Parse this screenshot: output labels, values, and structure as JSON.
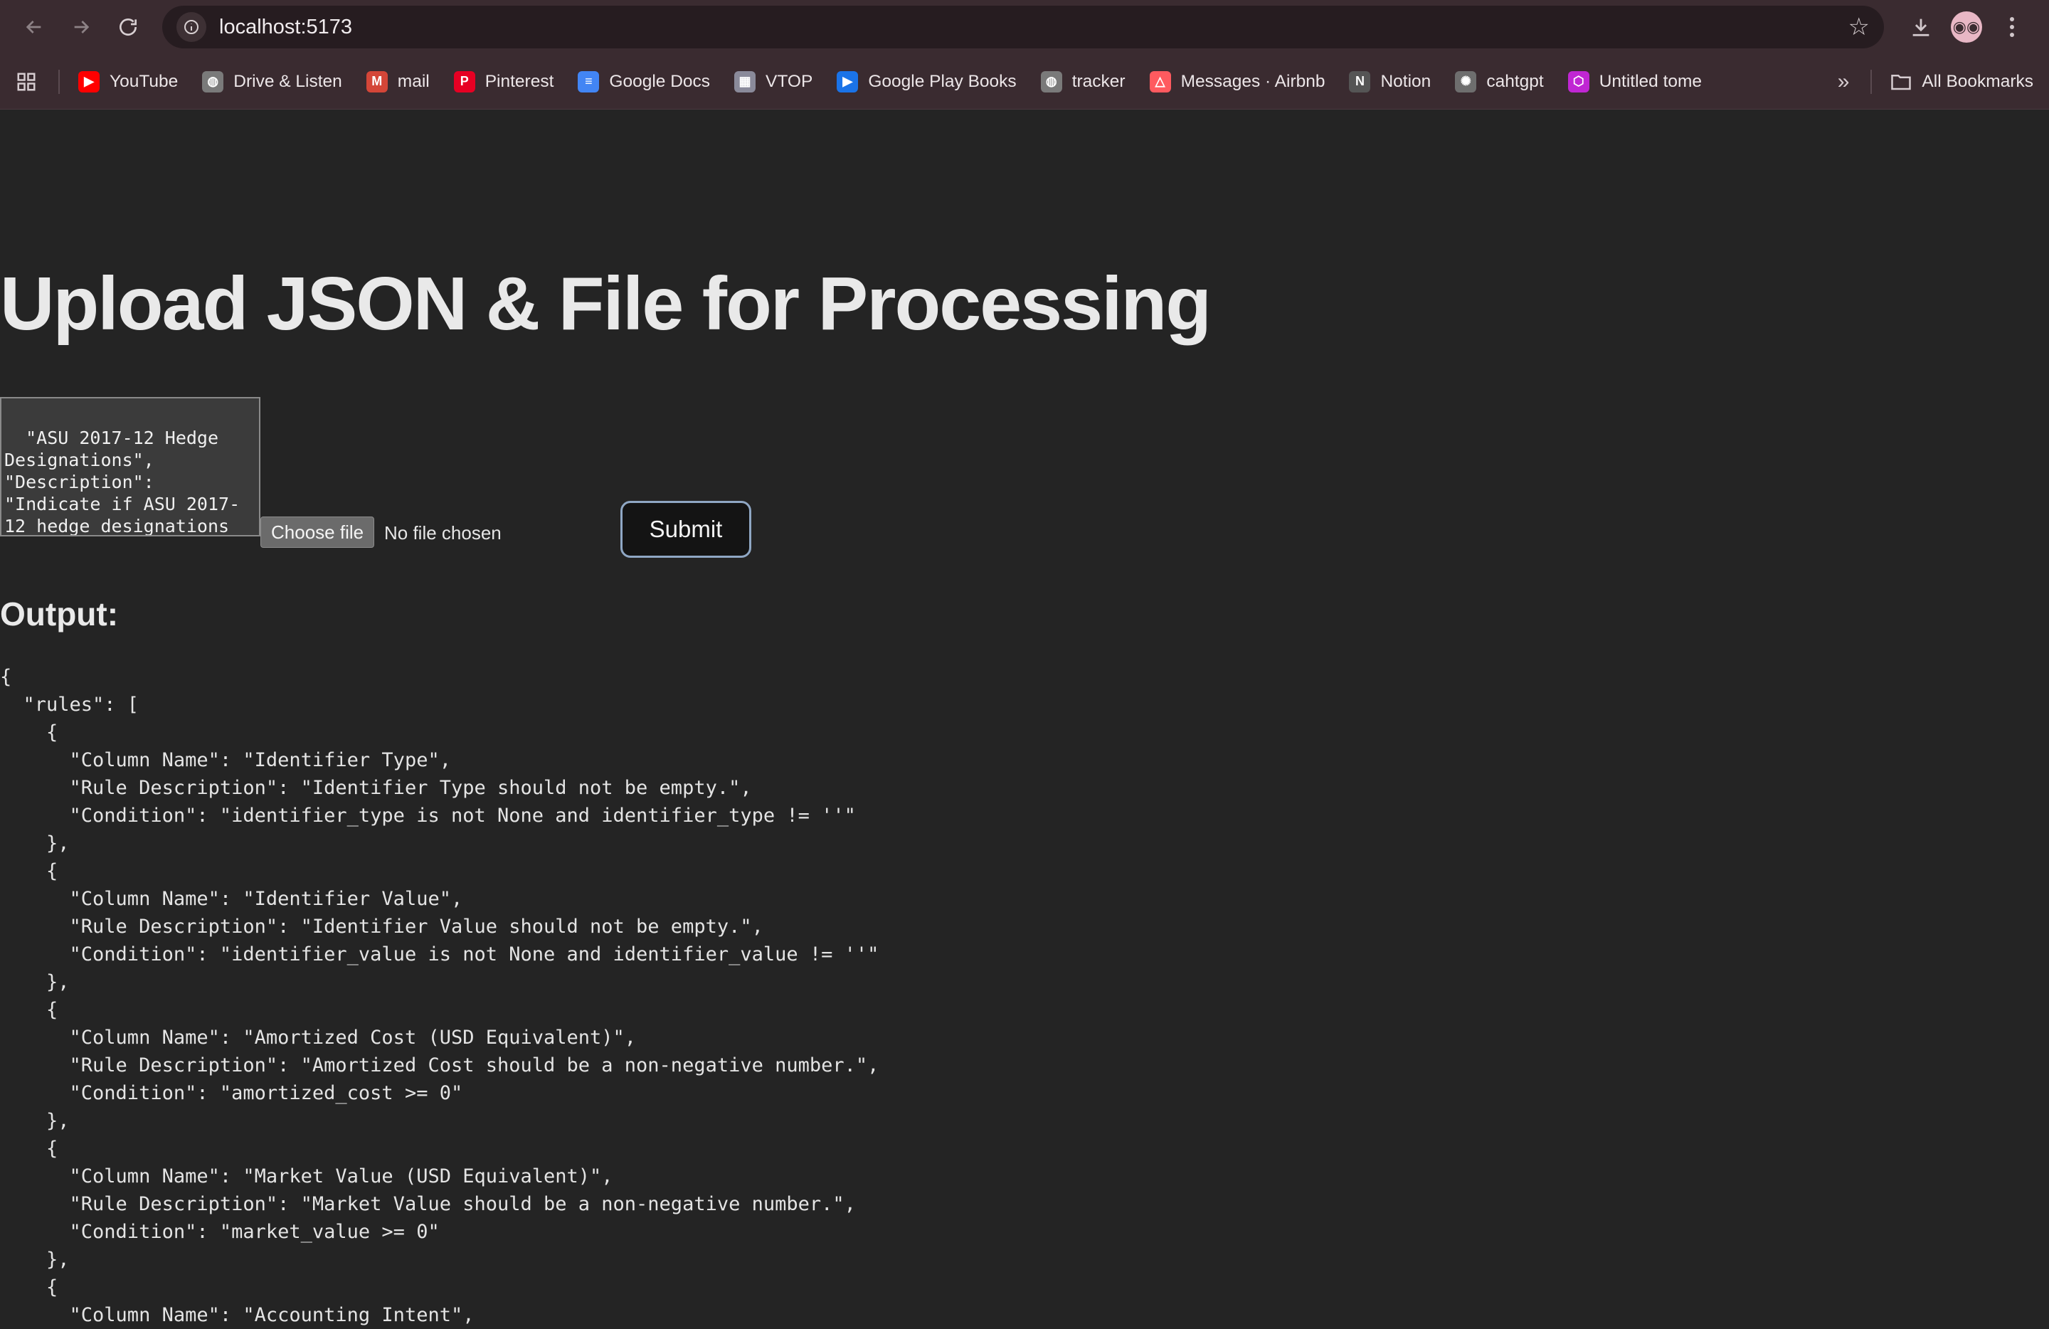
{
  "browser": {
    "url": "localhost:5173",
    "bookmarks": [
      {
        "label": "YouTube",
        "icon": "youtube-icon",
        "color": "#ff0000",
        "glyph": "▶"
      },
      {
        "label": "Drive & Listen",
        "icon": "globe-icon",
        "color": "#7a7a7a",
        "glyph": "◍"
      },
      {
        "label": "mail",
        "icon": "gmail-icon",
        "color": "#d44638",
        "glyph": "M"
      },
      {
        "label": "Pinterest",
        "icon": "pinterest-icon",
        "color": "#e60023",
        "glyph": "P"
      },
      {
        "label": "Google Docs",
        "icon": "google-docs-icon",
        "color": "#4285f4",
        "glyph": "≡"
      },
      {
        "label": "VTOP",
        "icon": "vtop-icon",
        "color": "#8a8a9a",
        "glyph": "▦"
      },
      {
        "label": "Google Play Books",
        "icon": "play-books-icon",
        "color": "#1a73e8",
        "glyph": "▶"
      },
      {
        "label": "tracker",
        "icon": "globe-icon",
        "color": "#7a7a7a",
        "glyph": "◍"
      },
      {
        "label": "Messages · Airbnb",
        "icon": "airbnb-icon",
        "color": "#ff5a5f",
        "glyph": "△"
      },
      {
        "label": "Notion",
        "icon": "notion-icon",
        "color": "#555555",
        "glyph": "N"
      },
      {
        "label": "cahtgpt",
        "icon": "chatgpt-icon",
        "color": "#6e6e6e",
        "glyph": "✺"
      },
      {
        "label": "Untitled tome",
        "icon": "tome-icon",
        "color": "#c026d3",
        "glyph": "⬡"
      }
    ],
    "all_bookmarks_label": "All Bookmarks"
  },
  "page": {
    "title": "Upload JSON & File for Processing",
    "json_input_text": "  \"ASU 2017-12 Hedge Designations\",\n\"Description\":\n\"Indicate if ASU 2017-12 hedge designations are applicable...\"}\n    ]",
    "choose_file_label": "Choose file",
    "file_status": "No file chosen",
    "submit_label": "Submit",
    "output_heading": "Output:",
    "output_text": "{\n  \"rules\": [\n    {\n      \"Column Name\": \"Identifier Type\",\n      \"Rule Description\": \"Identifier Type should not be empty.\",\n      \"Condition\": \"identifier_type is not None and identifier_type != ''\"\n    },\n    {\n      \"Column Name\": \"Identifier Value\",\n      \"Rule Description\": \"Identifier Value should not be empty.\",\n      \"Condition\": \"identifier_value is not None and identifier_value != ''\"\n    },\n    {\n      \"Column Name\": \"Amortized Cost (USD Equivalent)\",\n      \"Rule Description\": \"Amortized Cost should be a non-negative number.\",\n      \"Condition\": \"amortized_cost >= 0\"\n    },\n    {\n      \"Column Name\": \"Market Value (USD Equivalent)\",\n      \"Rule Description\": \"Market Value should be a non-negative number.\",\n      \"Condition\": \"market_value >= 0\"\n    },\n    {\n      \"Column Name\": \"Accounting Intent\","
  }
}
